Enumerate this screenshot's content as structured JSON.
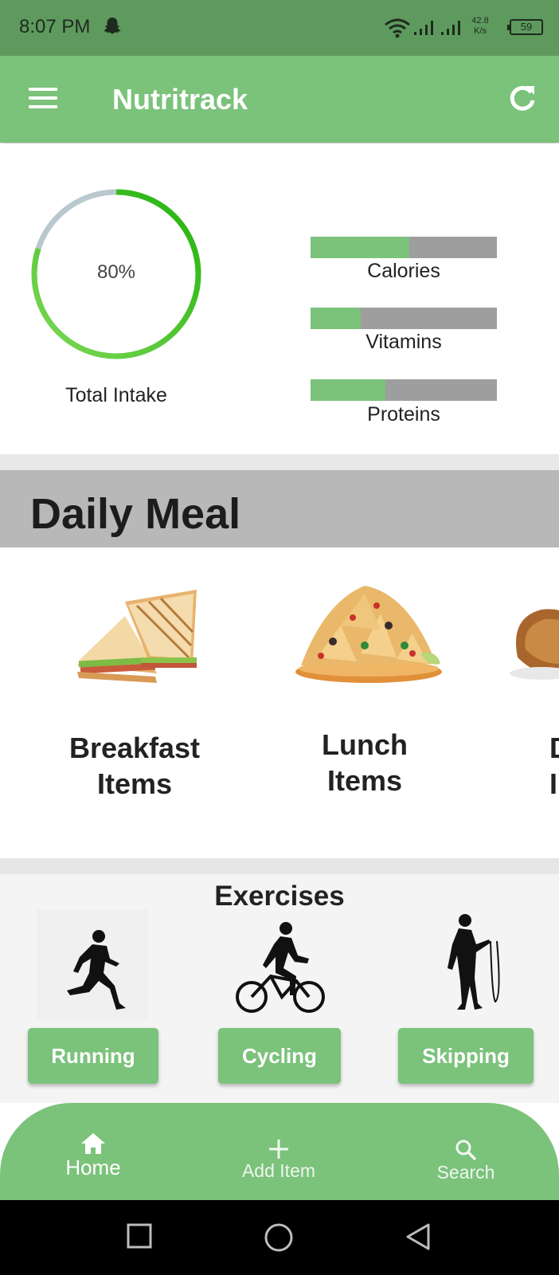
{
  "status_bar": {
    "time": "8:07 PM",
    "speed_value": "42.8",
    "speed_unit": "K/s",
    "battery": "59"
  },
  "app_bar": {
    "title": "Nutritrack",
    "menu_icon": "hamburger-menu-icon",
    "refresh_icon": "refresh-icon",
    "color": "#7bc27b"
  },
  "intake": {
    "ring_value": "80%",
    "ring_fraction": 0.8,
    "ring_label": "Total Intake",
    "bars": [
      {
        "label": "Calories",
        "fraction": 0.53
      },
      {
        "label": "Vitamins",
        "fraction": 0.27
      },
      {
        "label": "Proteins",
        "fraction": 0.4
      }
    ]
  },
  "daily_meal": {
    "title": "Daily Meal",
    "items": [
      {
        "line1": "Breakfast",
        "line2": "Items",
        "icon": "sandwich-icon"
      },
      {
        "line1": "Lunch",
        "line2": "Items",
        "icon": "nachos-icon"
      },
      {
        "line1": "D",
        "line2": "I",
        "icon": "roast-chicken-icon"
      }
    ]
  },
  "exercises": {
    "title": "Exercises",
    "items": [
      {
        "label": "Running",
        "icon": "runner-icon"
      },
      {
        "label": "Cycling",
        "icon": "cyclist-icon"
      },
      {
        "label": "Skipping",
        "icon": "skipping-rope-icon"
      }
    ]
  },
  "bottom_nav": {
    "items": [
      {
        "label": "Home",
        "icon": "home-icon"
      },
      {
        "label": "Add Item",
        "icon": "plus-icon"
      },
      {
        "label": "Search",
        "icon": "search-icon"
      }
    ]
  },
  "colors": {
    "accent": "#7bc27b",
    "status_bar": "#5e9a5e",
    "ring_start": "#7ed957",
    "ring_end": "#22b30b",
    "ring_track": "#b9c8cf",
    "bar_track": "#9e9e9e",
    "header_gray": "#b8b8b8"
  }
}
